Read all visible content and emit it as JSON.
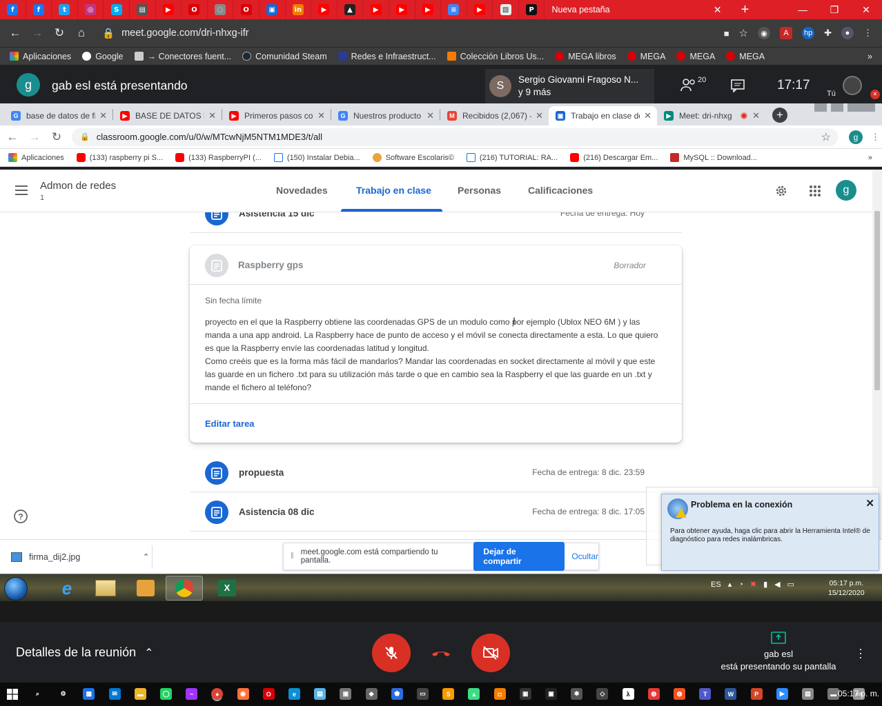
{
  "outer": {
    "tab_icons": [
      "facebook-icon",
      "facebook-icon",
      "twitter-icon",
      "instagram-icon",
      "skype-icon",
      "page-icon",
      "youtube-icon",
      "opera-icon",
      "loading-icon",
      "opera-icon",
      "classroom-icon",
      "hangouts-icon",
      "youtube-icon",
      "warning-icon",
      "youtube-icon",
      "youtube-icon",
      "youtube-icon",
      "docs-icon",
      "youtube-icon",
      "image-icon",
      "user-icon"
    ],
    "active_tab": "Nueva pestaña",
    "url": "meet.google.com/dri-nhxg-ifr",
    "bookmarks": [
      "Aplicaciones",
      "Google",
      "→ Conectores fuent...",
      "Comunidad Steam",
      "Redes e Infraestruct...",
      "Colección Libros Us...",
      "MEGA libros",
      "MEGA",
      "MEGA",
      "MEGA"
    ]
  },
  "meet": {
    "presenter_initial": "g",
    "presenting_title": "gab esl está presentando",
    "pres_initial": "S",
    "pres_name": "Sergio Giovanni Fragoso N...",
    "pres_more": "y 9 más",
    "participants": "20",
    "clock": "17:17",
    "you": "Tú",
    "details": "Detalles de la reunión",
    "bottom_presenter": "gab esl",
    "bottom_presenting": "está presentando su pantalla"
  },
  "inner": {
    "tabs": [
      {
        "label": "base de datos de fi",
        "icon": "google-icon"
      },
      {
        "label": "BASE DE DATOS EN",
        "icon": "youtube-icon"
      },
      {
        "label": "Primeros pasos cor",
        "icon": "youtube-icon"
      },
      {
        "label": "Nuestros producto",
        "icon": "google-icon"
      },
      {
        "label": "Recibidos (2,067) -",
        "icon": "gmail-icon"
      },
      {
        "label": "Trabajo en clase de",
        "icon": "classroom-icon"
      },
      {
        "label": "Meet: dri-nhxg",
        "icon": "meet-icon"
      }
    ],
    "url": "classroom.google.com/u/0/w/MTcwNjM5NTM1MDE3/t/all",
    "avatar": "g",
    "bookmarks": [
      "Aplicaciones",
      "(133) raspberry pi S...",
      "(133) RaspberryPI (...",
      "(150) Instalar Debia...",
      "Software Escolaris©",
      "(216) TUTORIAL: RA...",
      "(216) Descargar Em...",
      "MySQL :: Download..."
    ]
  },
  "classroom": {
    "class_name": "Admon de redes",
    "section": "1",
    "tabs": [
      "Novedades",
      "Trabajo en clase",
      "Personas",
      "Calificaciones"
    ],
    "avatar": "g",
    "top_row": {
      "title": "Asistencia 15 dic",
      "due": "Fecha de entrega: Hoy"
    },
    "card": {
      "title": "Raspberry gps",
      "status": "Borrador",
      "no_limit": "Sin fecha límite",
      "body1": "proyecto en el que la Raspberry obtiene las coordenadas GPS de un modulo como por ejemplo (Ublox NEO 6M ) y las manda a una app android. La Raspberry hace de punto de acceso y el móvil se conecta directamente a esta. Lo que quiero es que la Raspberry envíe las coordenadas latitud y longitud.",
      "body2": "Como creéis que es la forma más fácil de mandarlos? Mandar las coordenadas en socket directamente al móvil y que este las guarde en un fichero .txt para su utilización más tarde o que en cambio sea la Raspberry el que las guarde en un .txt y mande el fichero al teléfono?",
      "edit": "Editar tarea"
    },
    "rows": [
      {
        "title": "propuesta",
        "due": "Fecha de entrega: 8 dic. 23:59"
      },
      {
        "title": "Asistencia 08 dic",
        "due": "Fecha de entrega: 8 dic. 17:05"
      }
    ]
  },
  "download": {
    "file": "firma_dij2.jpg"
  },
  "share_bar": {
    "text": "meet.google.com está compartiendo tu pantalla.",
    "stop": "Dejar de compartir",
    "hide": "Ocultar"
  },
  "notification": {
    "title": "Problema en la conexión",
    "body": "Para obtener ayuda, haga clic para abrir la Herramienta Intel® de diagnóstico para redes inalámbricas."
  },
  "win7": {
    "lang": "ES",
    "time": "05:17 p.m.",
    "date": "15/12/2020"
  },
  "win10": {
    "time": "05:17 p. m."
  }
}
